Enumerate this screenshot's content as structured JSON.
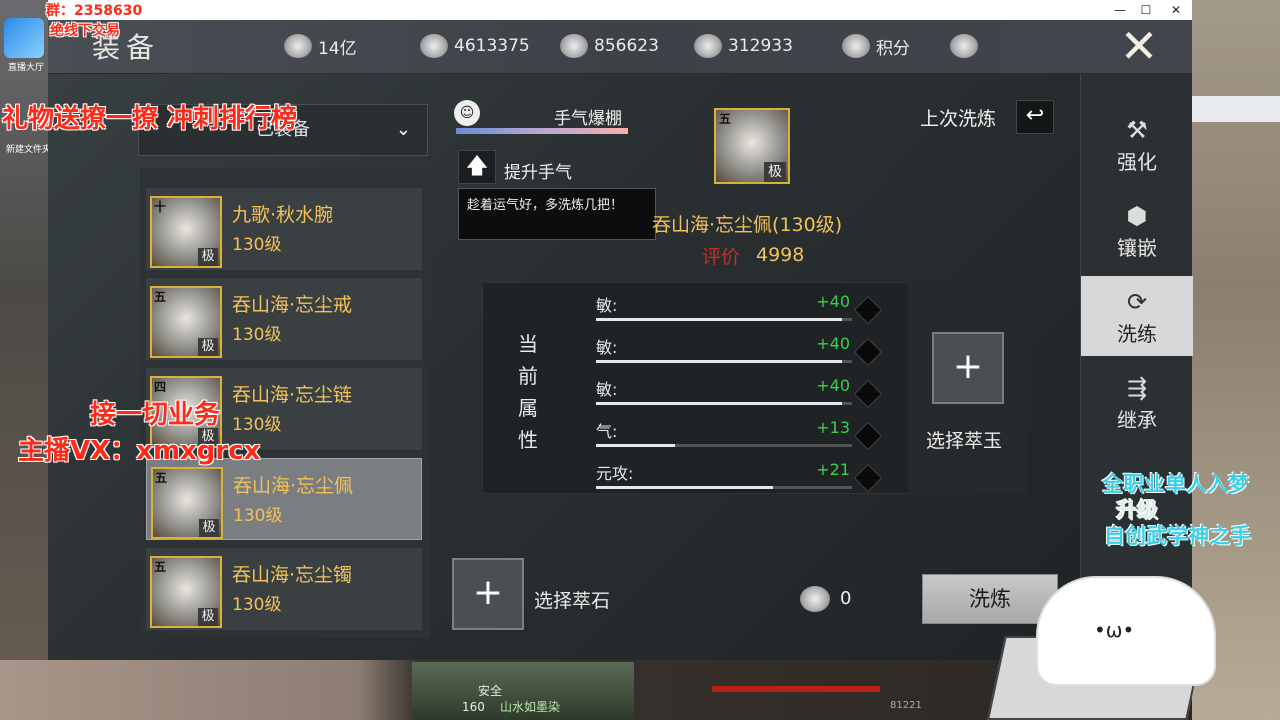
{
  "window": {
    "min": "—",
    "max": "☐",
    "close": "✕"
  },
  "header": {
    "title": "装备",
    "currencies": [
      {
        "icon": "coin-icon",
        "value": "14亿"
      },
      {
        "icon": "silver-ingot-icon",
        "value": "4613375"
      },
      {
        "icon": "jade-icon",
        "value": "856623"
      },
      {
        "icon": "bowl-icon",
        "value": "312933"
      },
      {
        "icon": "shield-points-icon",
        "value": "积分"
      }
    ]
  },
  "dropdown": {
    "label": "已装备",
    "chevron": "⌄"
  },
  "items": [
    {
      "tier": "十",
      "name": "九歌·秋水腕",
      "level": "130级",
      "grade": "极"
    },
    {
      "tier": "五",
      "name": "吞山海·忘尘戒",
      "level": "130级",
      "grade": "极"
    },
    {
      "tier": "四",
      "name": "吞山海·忘尘链",
      "level": "130级",
      "grade": "极"
    },
    {
      "tier": "五",
      "name": "吞山海·忘尘佩",
      "level": "130级",
      "grade": "极"
    },
    {
      "tier": "五",
      "name": "吞山海·忘尘镯",
      "level": "130级",
      "grade": "极"
    }
  ],
  "luck": {
    "label": "手气爆棚",
    "level": 0.9,
    "up_label": "提升手气",
    "tip": "趁着运气好，多洗炼几把！"
  },
  "equip": {
    "tier": "五",
    "grade": "极",
    "name": "吞山海·忘尘佩(130级)",
    "score_label": "评价",
    "score": "4998"
  },
  "last": {
    "label": "上次洗炼"
  },
  "attrs_caption": [
    "当",
    "前",
    "属",
    "性"
  ],
  "attrs": [
    {
      "name": "敏:",
      "value": "+40",
      "fill": 0.96
    },
    {
      "name": "敏:",
      "value": "+40",
      "fill": 0.96
    },
    {
      "name": "敏:",
      "value": "+40",
      "fill": 0.96
    },
    {
      "name": "气:",
      "value": "+13",
      "fill": 0.31
    },
    {
      "name": "元攻:",
      "value": "+21",
      "fill": 0.69
    }
  ],
  "jade": {
    "plus": "+",
    "label": "选择萃玉"
  },
  "stone": {
    "plus": "+",
    "label": "选择萃石"
  },
  "cost": {
    "value": "0"
  },
  "refine": {
    "label": "洗炼"
  },
  "sidebar": [
    {
      "icon": "hammer-icon",
      "glyph": "⚒",
      "label": "强化"
    },
    {
      "icon": "gem-icon",
      "glyph": "⬢",
      "label": "镶嵌"
    },
    {
      "icon": "refresh-icon",
      "glyph": "⟳",
      "label": "洗练"
    },
    {
      "icon": "inherit-icon",
      "glyph": "⇶",
      "label": "继承"
    }
  ],
  "hud": {
    "safe": "安全",
    "level": "160",
    "location": "山水如墨染",
    "num": "81221"
  },
  "overlay": {
    "qq": "群：2358630",
    "trade": "绝线下交易",
    "gift": "礼物送撩一撩 冲刺排行榜",
    "biz": "接一切业务",
    "vx": "主播VX：xmxgrcx",
    "r1": "全职业单人入梦",
    "r2": "升级",
    "r3": "自创武学神之手",
    "desk1": "直播大厅",
    "desk2": "新建文件夹"
  }
}
